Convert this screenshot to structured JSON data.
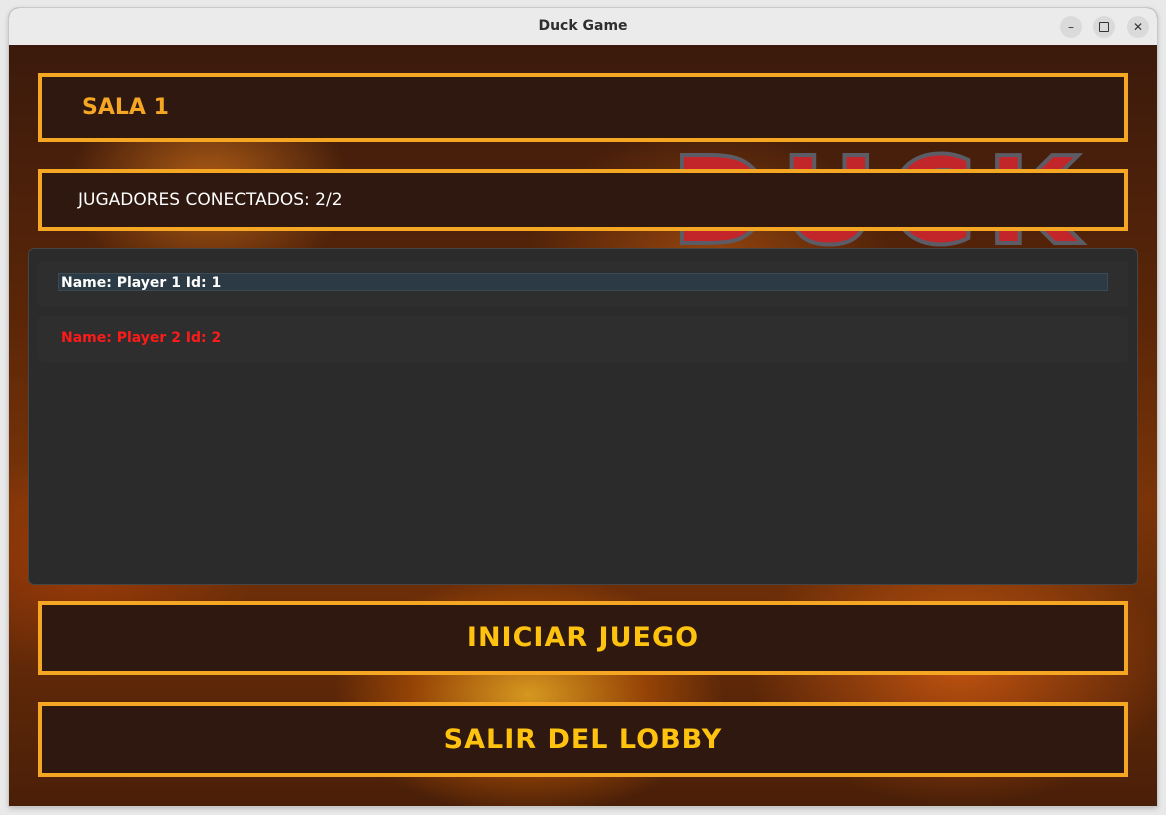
{
  "window": {
    "title": "Duck Game",
    "controls": {
      "minimize": "–",
      "maximize": "□",
      "close": "✕"
    }
  },
  "background": {
    "logo_text": "DUCK"
  },
  "lobby": {
    "room_title": "SALA 1",
    "connected_players": "JUGADORES CONECTADOS: 2/2",
    "players": [
      {
        "label": "Name: Player 1 Id: 1",
        "color": "#ffffff",
        "selected": true
      },
      {
        "label": "Name: Player 2 Id: 2",
        "color": "#ff1a1a",
        "selected": false
      }
    ],
    "start_button": "INICIAR JUEGO",
    "leave_button": "SALIR DEL LOBBY"
  },
  "colors": {
    "accent_border": "#f5a623",
    "button_text": "#ffc30f",
    "panel_bg": "#2e1810",
    "list_bg": "#2b2b2b"
  }
}
